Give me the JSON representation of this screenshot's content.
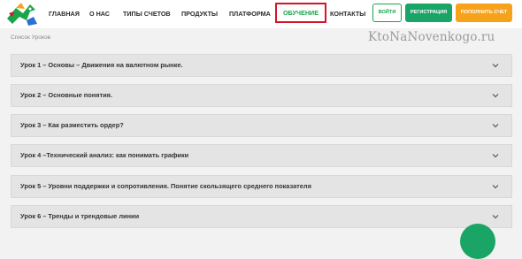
{
  "nav": {
    "items": [
      {
        "label": "ГЛАВНАЯ"
      },
      {
        "label": "О НАС"
      },
      {
        "label": "ТИПЫ СЧЕТОВ"
      },
      {
        "label": "ПРОДУКТЫ"
      },
      {
        "label": "ПЛАТФОРМА"
      },
      {
        "label": "ОБУЧЕНИЕ"
      },
      {
        "label": "КОНТАКТЫ"
      }
    ],
    "active_index": 5
  },
  "buttons": {
    "login": "ВОЙТИ",
    "register": "РЕГИСТРАЦИЯ",
    "deposit": "ПОПОЛНИТЬ СЧЕТ"
  },
  "watermark": "KtoNaNovenkogo.ru",
  "breadcrumb": "Список Уроков",
  "lessons": [
    {
      "title": "Урок 1 – Основы – Движения на валютном рынке."
    },
    {
      "title": "Урок 2 – Основные понятия."
    },
    {
      "title": "Урок 3 – Как разместить ордер?"
    },
    {
      "title": "Урок 4 –Технический анализ: как понимать графики"
    },
    {
      "title": "Урок 5 – Уровни поддержки и сопротивления. Понятие скользящего среднего показателя"
    },
    {
      "title": "Урок 6 – Тренды и трендовые линии"
    }
  ],
  "colors": {
    "accent_green": "#1aa54b",
    "register_green": "#1aa566",
    "deposit_orange": "#f7a21b",
    "highlight_red": "#d3142b"
  },
  "icons": {
    "logo": "bull-logo-icon",
    "expand": "chevron-down-icon"
  }
}
